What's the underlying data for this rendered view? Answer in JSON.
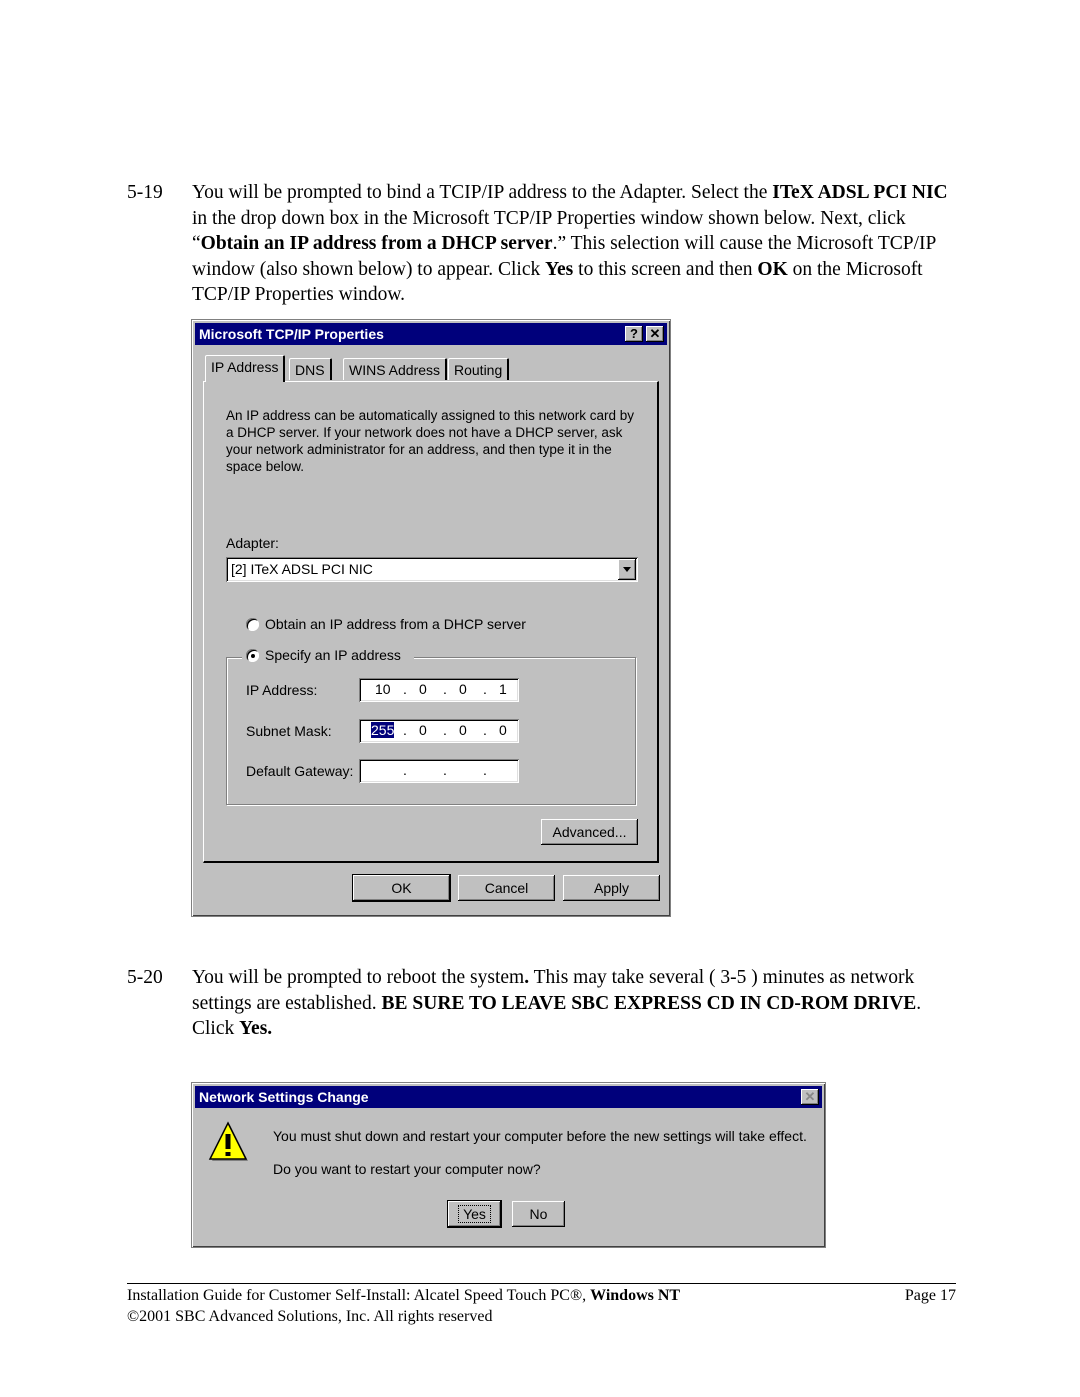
{
  "step_519": {
    "number": "5-19",
    "t1": "You will be prompted to bind a TCIP/IP address to the Adapter.  Select the ",
    "b1": "ITeX ADSL PCI NIC",
    "t2": " in the drop down box in the Microsoft TCP/IP Properties window shown below.  Next, click “",
    "b2": "Obtain an IP address from a DHCP server",
    "t3": ".”  This selection will cause the Microsoft TCP/IP window (also shown below) to appear.  Click ",
    "b3": "Yes",
    "t4": " to this screen and then ",
    "b4": "OK",
    "t5": " on the Microsoft TCP/IP Properties window."
  },
  "tcpip_dialog": {
    "title": "Microsoft TCP/IP Properties",
    "help_glyph": "?",
    "close_glyph": "✕",
    "tabs": [
      "IP Address",
      "DNS",
      "WINS Address",
      "Routing"
    ],
    "active_tab": "IP Address",
    "description": "An IP address can be automatically assigned to this network card by a DHCP server.  If your network does not have a DHCP server, ask your network administrator for an address, and then type it in the space below.",
    "adapter_label": "Adapter:",
    "adapter_value": "[2] ITeX ADSL PCI NIC",
    "radio_dhcp": "Obtain an IP address from a DHCP server",
    "radio_specify": "Specify an IP address",
    "selected_radio": "Specify an IP address",
    "ip_label": "IP Address:",
    "ip_octets": [
      "10",
      "0",
      "0",
      "1"
    ],
    "mask_label": "Subnet Mask:",
    "mask_octets": [
      "255",
      "0",
      "0",
      "0"
    ],
    "gateway_label": "Default Gateway:",
    "gateway_octets": [
      "",
      "",
      "",
      ""
    ],
    "advanced_button": "Advanced...",
    "ok_button": "OK",
    "cancel_button": "Cancel",
    "apply_button": "Apply"
  },
  "step_520": {
    "number": "5-20",
    "t1": "You will be prompted to reboot the system",
    "b1": ".",
    "t2": "  This may take several ( 3-5 ) minutes as network settings are established.  ",
    "b2": "BE SURE TO LEAVE SBC EXPRESS CD IN CD-ROM DRIVE",
    "t3": ".  Click ",
    "b3": "Yes."
  },
  "network_dialog": {
    "title": "Network Settings Change",
    "close_glyph": "✕",
    "message1": "You must shut down and restart your computer before the new settings will take effect.",
    "message2": "Do you want to restart your computer now?",
    "yes_button": "Yes",
    "no_button": "No"
  },
  "footer": {
    "guide_text": "Installation Guide for Customer Self-Install: Alcatel Speed Touch PC®, ",
    "guide_bold": "Windows NT",
    "page": "Page 17",
    "copyright": "©2001 SBC Advanced Solutions, Inc.  All rights reserved"
  }
}
